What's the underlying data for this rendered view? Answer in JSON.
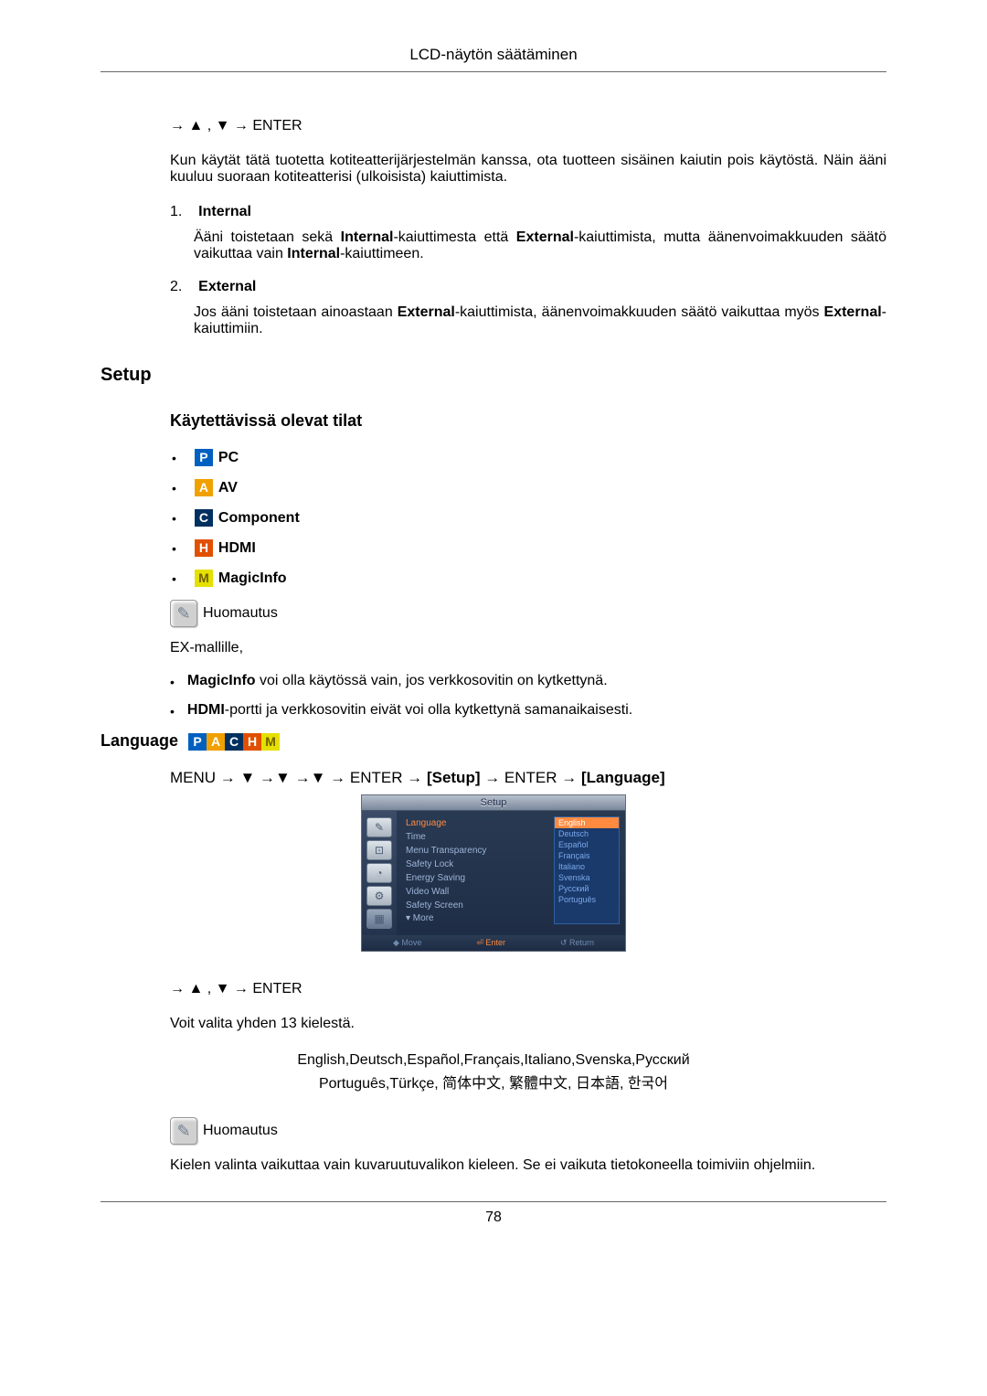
{
  "header": {
    "title": "LCD-näytön säätäminen"
  },
  "nav1": "→ ▲ , ▼ → ENTER",
  "intro_para": "Kun käytät tätä tuotetta kotiteatterijärjestelmän kanssa, ota tuotteen sisäinen kaiutin pois käytöstä. Näin ääni kuuluu suoraan kotiteatterisi (ulkoisista) kaiuttimista.",
  "items": [
    {
      "num": "1.",
      "title": "Internal",
      "body_parts": [
        "Ääni toistetaan sekä ",
        "Internal",
        "-kaiuttimesta että ",
        "External",
        "-kaiuttimista, mutta äänenvoimakkuuden säätö vaikuttaa vain ",
        "Internal",
        "-kaiuttimeen."
      ]
    },
    {
      "num": "2.",
      "title": "External",
      "body_parts": [
        "Jos ääni toistetaan ainoastaan ",
        "External",
        "-kaiuttimista, äänenvoimakkuuden säätö vaikuttaa myös ",
        "External",
        "-kaiuttimiin."
      ]
    }
  ],
  "setup": {
    "heading": "Setup",
    "modes_heading": "Käytettävissä olevat tilat",
    "modes": [
      {
        "letter": "P",
        "cls": "icon-P",
        "label": "PC"
      },
      {
        "letter": "A",
        "cls": "icon-A",
        "label": "AV"
      },
      {
        "letter": "C",
        "cls": "icon-C",
        "label": "Component"
      },
      {
        "letter": "H",
        "cls": "icon-H",
        "label": "HDMI"
      },
      {
        "letter": "M",
        "cls": "icon-M",
        "label": "MagicInfo"
      }
    ],
    "note_label": "Huomautus",
    "ex_line": "EX-mallille,",
    "bullets": [
      {
        "pre": "",
        "b": "MagicInfo",
        "post": " voi olla käytössä vain, jos verkkosovitin on kytkettynä."
      },
      {
        "pre": "",
        "b": "HDMI",
        "post": "-portti ja verkkosovitin eivät voi olla kytkettynä samanaikaisesti."
      }
    ]
  },
  "language": {
    "heading": "Language",
    "menu_path": {
      "p1": "MENU → ▼ →▼ →▼ → ENTER → ",
      "b1": "[Setup]",
      "p2": " → ENTER → ",
      "b2": "[Language]"
    },
    "osd": {
      "title": "Setup",
      "tabs_glyphs": [
        "✎",
        "⊡",
        "◔",
        "⚙",
        "▦"
      ],
      "menu": [
        "Language",
        "Time",
        "Menu Transparency",
        "Safety Lock",
        "Energy Saving",
        "Video Wall",
        "Safety Screen"
      ],
      "more": "▾ More",
      "langs": [
        "English",
        "Deutsch",
        "Español",
        "Français",
        "Italiano",
        "Svenska",
        "Русский",
        "Português"
      ],
      "footer": {
        "move": "◆ Move",
        "enter": "⏎ Enter",
        "return": "↺ Return"
      }
    },
    "nav2": "→ ▲ , ▼ → ENTER",
    "choose_text": "Voit valita yhden 13 kielestä.",
    "lang_list_l1": "English,Deutsch,Español,Français,Italiano,Svenska,Русский",
    "lang_list_l2": "Português,Türkçe, 简体中文,  繁體中文, 日本語, 한국어",
    "note_label": "Huomautus",
    "final_para": "Kielen valinta vaikuttaa vain kuvaruutuvalikon kieleen. Se ei vaikuta tietokoneella toimiviin ohjelmiin."
  },
  "page_number": "78"
}
